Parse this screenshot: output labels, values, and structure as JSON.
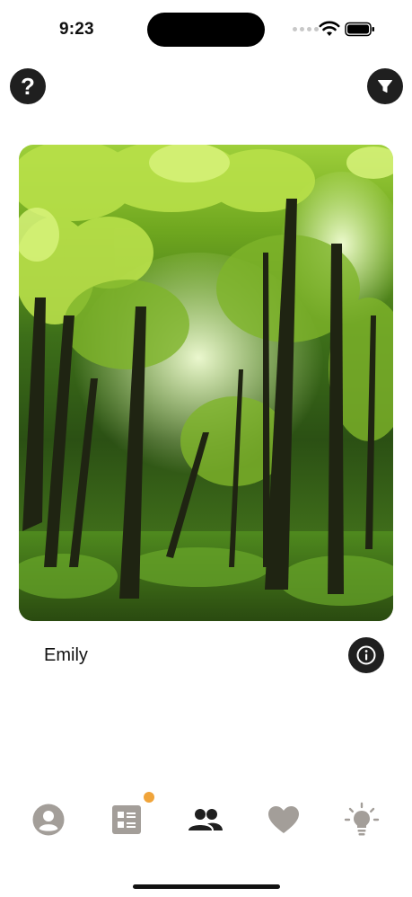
{
  "status_bar": {
    "time": "9:23"
  },
  "profile": {
    "name": "Emily"
  },
  "icons": {
    "help": "question-mark-icon",
    "filter": "funnel-icon",
    "info": "info-icon",
    "tabs": [
      "person-circle-icon",
      "feed-list-icon",
      "people-icon",
      "heart-icon",
      "lightbulb-icon"
    ]
  },
  "tab_bar": {
    "active_tab": "people",
    "feed_has_badge": true
  },
  "colors": {
    "dark": "#1f1f1f",
    "tab_inactive": "#a39e99",
    "tab_active": "#1f1f1f",
    "badge": "#f0a43a"
  }
}
